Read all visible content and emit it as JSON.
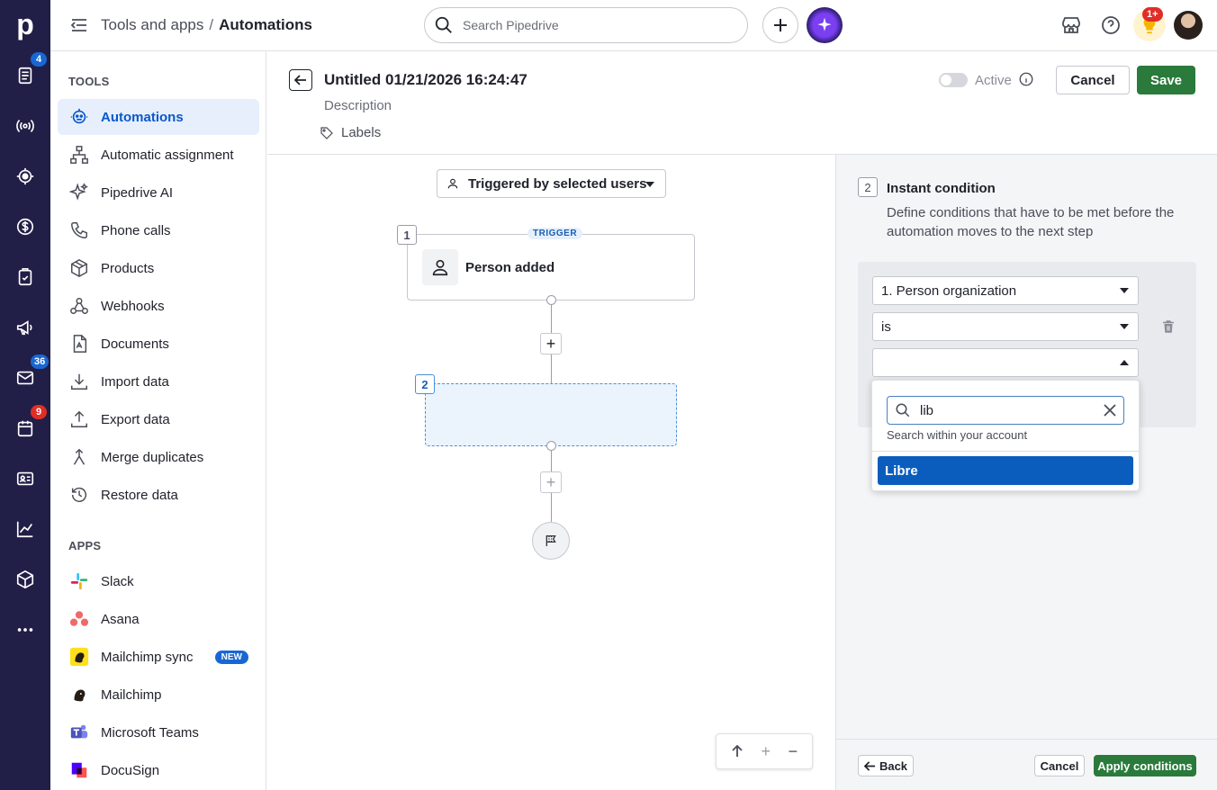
{
  "rail": {
    "logo": "p",
    "items": [
      {
        "icon": "deals-icon",
        "badge": "4",
        "badge_color": "#1967d2"
      },
      {
        "icon": "broadcast-icon"
      },
      {
        "icon": "target-icon"
      },
      {
        "icon": "dollar-icon"
      },
      {
        "icon": "checklist-icon"
      },
      {
        "icon": "megaphone-icon"
      },
      {
        "icon": "mail-icon",
        "badge": "36",
        "badge_color": "#1967d2"
      },
      {
        "icon": "calendar-icon",
        "badge": "9",
        "badge_color": "#e02d27"
      },
      {
        "icon": "contacts-card-icon"
      },
      {
        "icon": "chart-icon"
      },
      {
        "icon": "cube-icon"
      },
      {
        "icon": "more-icon"
      }
    ]
  },
  "header": {
    "breadcrumb_parent": "Tools and apps",
    "breadcrumb_sep": "/",
    "breadcrumb_current": "Automations",
    "search_placeholder": "Search Pipedrive",
    "notification_badge": "1+"
  },
  "sidebar": {
    "tools_heading": "TOOLS",
    "tools": [
      {
        "label": "Automations",
        "icon": "robot-icon",
        "active": true
      },
      {
        "label": "Automatic assignment",
        "icon": "hierarchy-icon"
      },
      {
        "label": "Pipedrive AI",
        "icon": "sparkle-icon"
      },
      {
        "label": "Phone calls",
        "icon": "phone-icon"
      },
      {
        "label": "Products",
        "icon": "box-icon"
      },
      {
        "label": "Webhooks",
        "icon": "webhook-icon"
      },
      {
        "label": "Documents",
        "icon": "document-icon"
      },
      {
        "label": "Import data",
        "icon": "import-icon"
      },
      {
        "label": "Export data",
        "icon": "export-icon"
      },
      {
        "label": "Merge duplicates",
        "icon": "merge-icon"
      },
      {
        "label": "Restore data",
        "icon": "restore-icon"
      }
    ],
    "apps_heading": "APPS",
    "apps": [
      {
        "label": "Slack",
        "icon": "slack-icon"
      },
      {
        "label": "Asana",
        "icon": "asana-icon"
      },
      {
        "label": "Mailchimp sync",
        "icon": "mailchimp-icon",
        "badge": "NEW"
      },
      {
        "label": "Mailchimp",
        "icon": "mailchimp-icon"
      },
      {
        "label": "Microsoft Teams",
        "icon": "teams-icon"
      },
      {
        "label": "DocuSign",
        "icon": "docusign-icon"
      }
    ]
  },
  "editor": {
    "title": "Untitled 01/21/2026 16:24:47",
    "description": "Description",
    "labels": "Labels",
    "active_label": "Active",
    "active": false,
    "cancel_label": "Cancel",
    "save_label": "Save"
  },
  "canvas": {
    "triggered_by": "Triggered by selected users",
    "trigger_step_num": "1",
    "trigger_tag": "TRIGGER",
    "trigger_label": "Person added",
    "step2_num": "2"
  },
  "panel": {
    "step_num": "2",
    "title": "Instant condition",
    "description": "Define conditions that have to be met before the automation moves to the next step",
    "field_select": "1. Person organization",
    "operator_select": "is",
    "value_select": "",
    "dropdown_search_value": "lib",
    "dropdown_hint": "Search within your account",
    "dropdown_option": "Libre",
    "back_label": "Back",
    "cancel_label": "Cancel",
    "apply_label": "Apply conditions"
  },
  "colors": {
    "rail_bg": "#211f47",
    "active_bg": "#e6effb",
    "active_text": "#0a58ca",
    "primary_green": "#2a7a3b",
    "selected_option": "#0a5dbc"
  }
}
